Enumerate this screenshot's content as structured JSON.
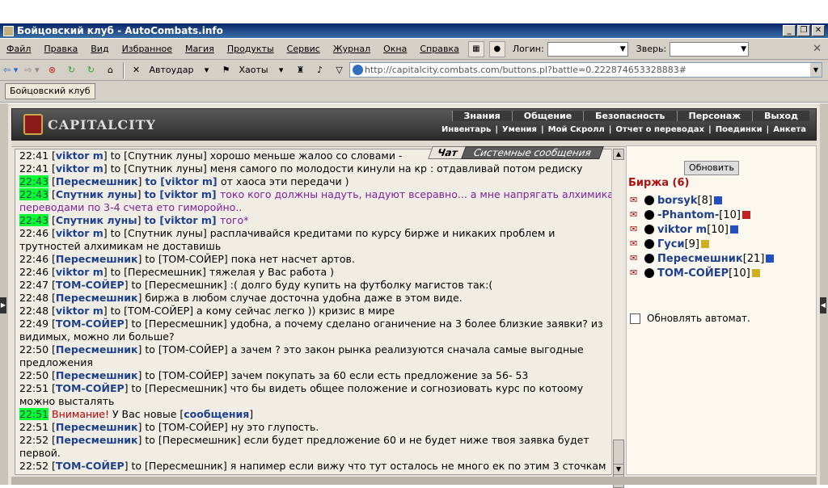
{
  "window": {
    "title": "Бойцовский клуб - AutoCombats.info",
    "controls": [
      "_",
      "❐",
      "✕"
    ]
  },
  "menu": {
    "items": [
      "Файл",
      "Правка",
      "Вид",
      "Избранное",
      "Магия",
      "Продукты",
      "Сервис",
      "Журнал",
      "Окна",
      "Справка"
    ],
    "login_label": "Логин:",
    "pet_label": "Зверь:",
    "close": "✕"
  },
  "toolbar": {
    "autohit": "Автоудар",
    "chaos": "Хаоты",
    "address": "http://capitalcity.combats.com/buttons.pl?battle=0.222874653328883#"
  },
  "tab": {
    "label": "Бойцовский клуб"
  },
  "banner": {
    "logo": "CAPITALCITY",
    "nav1": [
      "Знания",
      "Общение",
      "Безопасность",
      "Персонаж",
      "Выход"
    ],
    "nav2": [
      "Инвентарь",
      "Умения",
      "Мой Скролл",
      "Отчет о переводах",
      "Поединки",
      "Анкета"
    ]
  },
  "chat_tabs": {
    "chat": "Чат",
    "system": "Системные сообщения"
  },
  "chat": [
    {
      "time": "22:41",
      "from": "viktor m",
      "to": "Спутник луны",
      "text": "хорошо меньше жалоо со словами -"
    },
    {
      "time": "22:41",
      "from": "viktor m",
      "to": "Спутник луны",
      "text": "меня самого по молодости кинули на кр : отдавливай потом редиску"
    },
    {
      "time": "22:43",
      "hl": true,
      "from": "Пересмешник",
      "to_priv": "viktor m",
      "text": "от хаоса эти передачи )"
    },
    {
      "time": "22:43",
      "hl": true,
      "from": "Спутник луны",
      "to_priv": "viktor m",
      "text": "токо кого должны надуть, надуют всеравно... а мне напрягать алхимика переводами по 3-4 счета ето гиморойно..",
      "priv": true
    },
    {
      "time": "22:43",
      "hl": true,
      "from": "Спутник луны",
      "to_priv": "viktor m",
      "text": "того*",
      "priv": true
    },
    {
      "time": "22:46",
      "from": "viktor m",
      "to": "Спутник луны",
      "text": "расплачивайся кредитами по курсу бирже и никаких проблем и трутностей алхимикам не доставишь"
    },
    {
      "time": "22:46",
      "from": "Пересмешник",
      "to": "ТОМ-СОЙЕР",
      "text": "пока нет насчет артов."
    },
    {
      "time": "22:46",
      "from": "viktor m",
      "to": "Пересмешник",
      "text": "тяжелая у Вас работа )"
    },
    {
      "time": "22:47",
      "from": "ТОМ-СОЙЕР",
      "to": "Пересмешник",
      "text": ":( долго буду купить на футболку магистов так:("
    },
    {
      "time": "22:48",
      "from": "Пересмешник",
      "text": "биржа в любом случае досточна удобна даже в этом виде."
    },
    {
      "time": "22:48",
      "from": "viktor m",
      "to": "ТОМ-СОЙЕР",
      "text": "а кому сейчас легко )) кризис в мире"
    },
    {
      "time": "22:49",
      "from": "ТОМ-СОЙЕР",
      "to": "Пересмешник",
      "text": "удобна, а почему сделано оганичение на 3 более близкие заявки? из видимых, можно ли больше?"
    },
    {
      "time": "22:50",
      "from": "Пересмешник",
      "to": "ТОМ-СОЙЕР",
      "text": "а зачем ? это закон рынка реализуются сначала самые выгодные предложения"
    },
    {
      "time": "22:50",
      "from": "Пересмешник",
      "to": "ТОМ-СОЙЕР",
      "text": "зачем покупать за 60 если есть предложение за 56- 53"
    },
    {
      "time": "22:51",
      "from": "ТОМ-СОЙЕР",
      "to": "Пересмешник",
      "text": "что бы видеть общее положение и согнозиовать курс по котоому можно выстaлять"
    },
    {
      "time": "22:51",
      "hl": true,
      "warn": "Внимание!",
      "text": "У Вас новые",
      "link": "сообщения"
    },
    {
      "time": "22:51",
      "from": "Пересмешник",
      "to": "ТОМ-СОЙЕР",
      "text": "ну это глупость."
    },
    {
      "time": "22:52",
      "from": "Пересмешник",
      "to": "Пересмешник",
      "text": "если будет предложение 60 и не будет ниже твоя заявка будет первой."
    },
    {
      "time": "22:52",
      "from": "ТОМ-СОЙЕР",
      "to": "Пересмешник",
      "text": "я напимер если вижу что тут осталось не много ек по этим 3 сточкам хочу поставить выше но не вижу много ли там"
    }
  ],
  "right": {
    "refresh": "Обновить",
    "room": "Биржа (6)",
    "users": [
      {
        "nick": "borsyk",
        "level": "[8]",
        "info": "b"
      },
      {
        "nick": "-Phantom-",
        "level": "[10]",
        "info": "r"
      },
      {
        "nick": "viktor m",
        "level": "[10]",
        "info": "b"
      },
      {
        "nick": "Гуси",
        "level": "[9]",
        "info": "y"
      },
      {
        "nick": "Пересмешник",
        "level": "[21]",
        "info": "b"
      },
      {
        "nick": "ТОМ-СОЙЕР",
        "level": "[10]",
        "info": "y"
      }
    ],
    "auto": "Обновлять автомат."
  }
}
